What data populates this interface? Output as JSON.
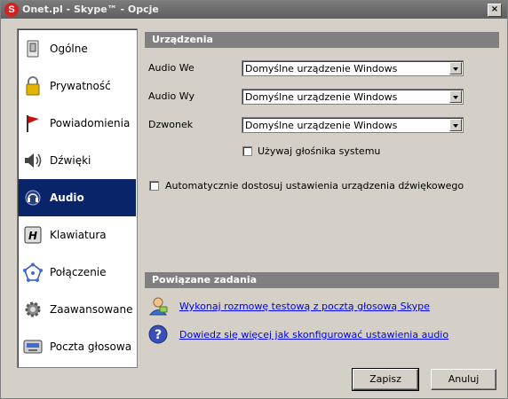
{
  "window": {
    "title": "Onet.pl - Skype™ - Opcje",
    "app_icon_letter": "S",
    "close_glyph": "×"
  },
  "sidebar": {
    "items": [
      {
        "label": "Ogólne",
        "icon": "general-switch-icon"
      },
      {
        "label": "Prywatność",
        "icon": "padlock-icon"
      },
      {
        "label": "Powiadomienia",
        "icon": "red-flag-icon"
      },
      {
        "label": "Dźwięki",
        "icon": "speaker-icon"
      },
      {
        "label": "Audio",
        "icon": "headset-icon",
        "active": true
      },
      {
        "label": "Klawiatura",
        "icon": "keyboard-key-icon"
      },
      {
        "label": "Połączenie",
        "icon": "network-icon"
      },
      {
        "label": "Zaawansowane",
        "icon": "gear-icon"
      },
      {
        "label": "Poczta głosowa",
        "icon": "voicemail-icon"
      }
    ]
  },
  "devices": {
    "header": "Urządzenia",
    "audio_in_label": "Audio We",
    "audio_in_value": "Domyślne urządzenie Windows",
    "audio_out_label": "Audio Wy",
    "audio_out_value": "Domyślne urządzenie Windows",
    "ringer_label": "Dzwonek",
    "ringer_value": "Domyślne urządzenie Windows",
    "system_speaker_label": "Używaj głośnika systemu",
    "system_speaker_checked": false,
    "auto_adjust_label": "Automatycznie dostosuj ustawienia urządzenia dźwiękowego",
    "auto_adjust_checked": false
  },
  "tasks": {
    "header": "Powiązane zadania",
    "test_call_link": "Wykonaj rozmowę testową z pocztą głosową Skype",
    "help_link": "Dowiedz się więcej jak skonfigurować ustawienia audio"
  },
  "buttons": {
    "save": "Zapisz",
    "cancel": "Anuluj"
  },
  "colors": {
    "active_nav": "#0a246a",
    "section_header": "#808080",
    "link": "#0000ee"
  }
}
